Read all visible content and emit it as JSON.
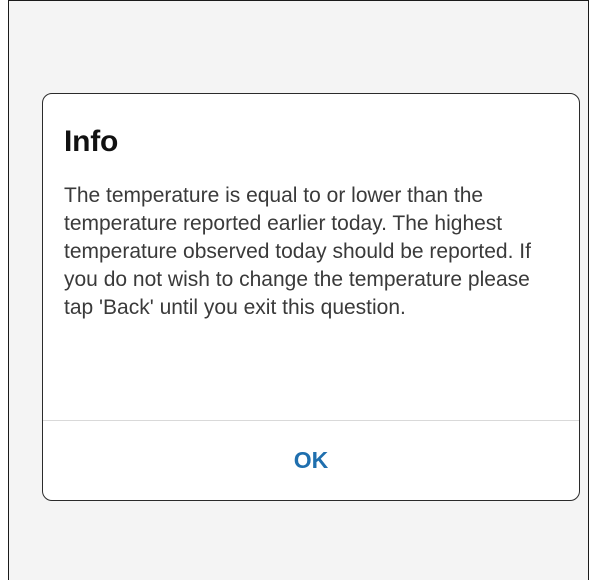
{
  "dialog": {
    "title": "Info",
    "message": "The temperature is equal to or lower than the temperature reported earlier today. The highest temperature observed today should be reported. If you do not wish to change the temperature please tap 'Back' until you exit this question.",
    "ok_label": "OK"
  },
  "colors": {
    "background": "#f4f4f4",
    "dialog_background": "#ffffff",
    "title_text": "#111111",
    "body_text": "#3a3a3a",
    "accent": "#1f6fae",
    "divider": "#d9d9d9"
  }
}
